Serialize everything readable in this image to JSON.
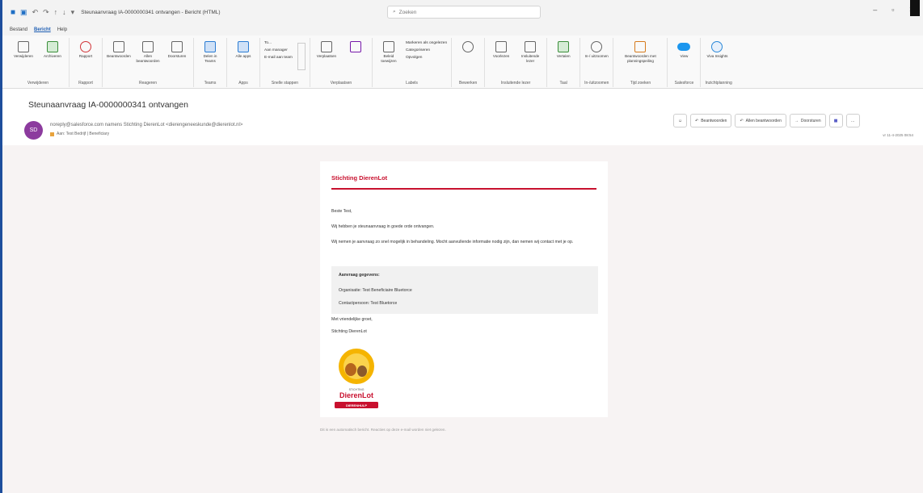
{
  "titlebar": {
    "window_title": "Steunaanvraag IA-0000000341 ontvangen - Bericht (HTML)",
    "search_placeholder": "Zoeken"
  },
  "menu": {
    "tabs": [
      "Bestand",
      "Bericht",
      "Help"
    ],
    "active": "Bericht"
  },
  "ribbon": {
    "groups": [
      {
        "label": "Verwijderen",
        "buttons": [
          "Verwijderen",
          "Archiveren"
        ]
      },
      {
        "label": "Rapport",
        "buttons": [
          "Rapport"
        ]
      },
      {
        "label": "Reageren",
        "buttons": [
          "Beantwoorden",
          "Allen beantwoorden",
          "Doorsturen"
        ]
      },
      {
        "label": "Teams",
        "buttons": [
          "Delen in Teams"
        ]
      },
      {
        "label": "Apps",
        "buttons": [
          "Alle apps"
        ]
      },
      {
        "label": "Snelle stappen",
        "list": [
          "To...",
          "Aan manager",
          "E-mail aan team"
        ]
      },
      {
        "label": "Verplaatsen",
        "buttons": [
          "Verplaatsen"
        ]
      },
      {
        "label": "Labels",
        "buttons": [
          "Beleid toewijzen"
        ],
        "list": [
          "Markeren als ongelezen",
          "Categoriseren",
          "Opvolgen"
        ]
      },
      {
        "label": "Bewerken",
        "buttons": [
          ""
        ]
      },
      {
        "label": "Insluitende lezer",
        "buttons": [
          "Voorlezen",
          "Insluitende lezer"
        ]
      },
      {
        "label": "Taal",
        "buttons": [
          "Vertalen"
        ]
      },
      {
        "label": "In-/uitzoomen",
        "buttons": [
          "In-/ uitzoomen"
        ]
      },
      {
        "label": "Tijd zoeken",
        "buttons": [
          "Beantwoorden met planningspeiling"
        ]
      },
      {
        "label": "Salesforce",
        "buttons": [
          "View"
        ]
      },
      {
        "label": "Inzichtplanning",
        "buttons": [
          "Viva Insights"
        ]
      }
    ]
  },
  "message": {
    "subject": "Steunaanvraag IA-0000000341 ontvangen",
    "avatar_initials": "SD",
    "sender": "noreply@salesforce.com namens Stichting DierenLot <dierengeneeskunde@dierenlot.nl>",
    "to": "Aan: Test Bedrijf | Beneficiary",
    "timestamp": "vr 11-4-2025 08:54",
    "actions": {
      "reply": "Beantwoorden",
      "reply_all": "Allen beantwoorden",
      "forward": "Doorsturen"
    }
  },
  "email": {
    "org_title": "Stichting DierenLot",
    "greeting": "Beste Test,",
    "p1": "Wij hebben je steunaanvraag in goede orde ontvangen.",
    "p2": "Wij nemen je aanvraag zo snel mogelijk in behandeling. Mocht aanvullende informatie nodig zijn, dan nemen wij contact met je op.",
    "details_title": "Aanvraag gegevens:",
    "detail_org": "Organisatie: Test Beneficiaire Bluetorce",
    "detail_contact": "Contactpersoon: Test Bluetorce",
    "closing": "Met vriendelijke groet,",
    "signature": "Stichting DierenLot",
    "logo_text": "DierenLot",
    "logo_subtext": "STICHTING",
    "logo_tagline": "DIERENHULP",
    "footer": "Dit is een automatisch bericht. Reacties op deze e-mail worden niet gelezen."
  }
}
